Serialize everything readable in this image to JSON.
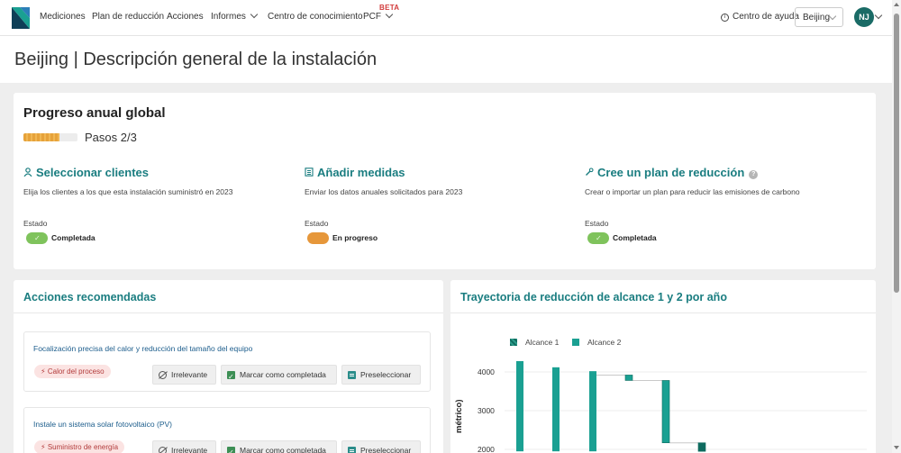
{
  "nav": {
    "items": [
      {
        "label": "Mediciones",
        "has_dropdown": false
      },
      {
        "label": "Plan de reducción",
        "has_dropdown": false
      },
      {
        "label": "Acciones",
        "has_dropdown": false
      },
      {
        "label": "Informes",
        "has_dropdown": true
      },
      {
        "label": "Centro de conocimiento",
        "has_dropdown": false
      },
      {
        "label": "PCF",
        "has_dropdown": true,
        "badge": "BETA"
      }
    ],
    "help_label": "Centro de ayuda",
    "facility_select": "Beijing",
    "user_initials": "NJ",
    "brand_color": "#1a6b66"
  },
  "page": {
    "title": "Beijing | Descripción general de la instalación"
  },
  "progress": {
    "title": "Progreso anual global",
    "steps_label": "Pasos 2/3",
    "progress_fraction": 0.67,
    "state_label": "Estado",
    "steps": [
      {
        "icon": "user-icon",
        "title": "Seleccionar clientes",
        "description": "Elija los clientes a los que esta instalación suministró en 2023",
        "status": "Completada",
        "status_color": "#7fc35c"
      },
      {
        "icon": "list-icon",
        "title": "Añadir medidas",
        "description": "Enviar los datos anuales solicitados para 2023",
        "status": "En progreso",
        "status_color": "#e6973a"
      },
      {
        "icon": "tool-icon",
        "title": "Cree un plan de reducción",
        "description": "Crear o importar un plan para reducir las emisiones de carbono",
        "status": "Completada",
        "status_color": "#7fc35c",
        "has_help": true
      }
    ]
  },
  "actions": {
    "title": "Acciones recomendadas",
    "items": [
      {
        "title": "Focalización precisa del calor y reducción del tamaño del equipo",
        "tag": "Calor del proceso"
      },
      {
        "title": "Instale un sistema solar fotovoltaico (PV)",
        "tag": "Suministro de energía"
      }
    ],
    "buttons": {
      "irrelevant": "Irrelevante",
      "complete": "Marcar como completada",
      "shortlist": "Preseleccionar"
    }
  },
  "chart": {
    "title": "Trayectoria de reducción de alcance 1 y 2 por año",
    "ylabel_partial": "métrico)",
    "legend": [
      "Alcance 1",
      "Alcance 2"
    ],
    "colors": {
      "scope1": "#0f6b5f",
      "scope2": "#1aa092",
      "connector": "#c9c9c9"
    }
  },
  "chart_data": {
    "type": "bar",
    "subtype": "waterfall",
    "title": "Trayectoria de reducción de alcance 1 y 2 por año",
    "ylabel": "métrico)",
    "yticks": [
      2000,
      3000,
      4000
    ],
    "visible_ylim": [
      1950,
      4400
    ],
    "legend": [
      "Alcance 1",
      "Alcance 2"
    ],
    "legend_position": "top-left",
    "grid": true,
    "bars": [
      {
        "top": 4280,
        "bottom": 1950,
        "type": "total",
        "series": "Alcance 2"
      },
      {
        "top": 4120,
        "bottom": 1950,
        "type": "total",
        "series": "Alcance 2"
      },
      {
        "top": 4020,
        "bottom": 1950,
        "type": "total",
        "series": "Alcance 2"
      },
      {
        "top": 3920,
        "bottom": 3780,
        "type": "step",
        "series": "Alcance 2"
      },
      {
        "top": 3780,
        "bottom": 2170,
        "type": "step",
        "series": "Alcance 2"
      },
      {
        "top": 2170,
        "bottom": 1950,
        "type": "step",
        "series": "Alcance 1"
      }
    ]
  }
}
